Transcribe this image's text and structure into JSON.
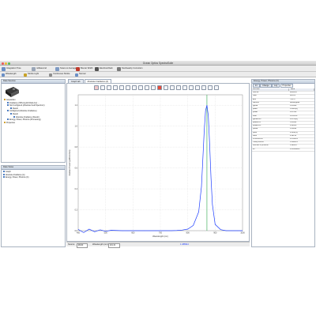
{
  "window": {
    "title": "Ocean Optics SpectraSuite"
  },
  "toolbar": {
    "buttons": [
      {
        "label": "Integration Time",
        "icon": "clock-icon",
        "color": "#6a8fc6"
      },
      {
        "label": "millisecond",
        "icon": "time-unit-icon",
        "color": "#9aa6b8"
      },
      {
        "label": "Scans to Average",
        "icon": "scans-icon",
        "color": "#7f9bc4"
      },
      {
        "label": "Boxcar Width",
        "icon": "boxcar-icon",
        "color": "#c0392b"
      },
      {
        "label": "Electrical Dark",
        "icon": "dark-icon",
        "color": "#555555"
      },
      {
        "label": "Nonlinearity Correction",
        "icon": "nonlinear-icon",
        "color": "#7a7a7a"
      }
    ]
  },
  "toolbar2": {
    "buttons": [
      {
        "label": "Wavelength",
        "icon": "wavelength-icon",
        "color": "#6a8fc6"
      },
      {
        "label": "Strobe Light",
        "icon": "strobe-icon",
        "color": "#c9a227"
      },
      {
        "label": "Continuous Strobe",
        "icon": "continuous-strobe-icon",
        "color": "#8d8d8d"
      },
      {
        "label": "Normal",
        "icon": "mode-icon",
        "color": "#6a8fc6"
      }
    ]
  },
  "left_panel": {
    "header": "Data Sources",
    "tree": [
      {
        "label": "Acquisition",
        "depth": 0
      },
      {
        "label": "Irradiance (ISIS-ing EX-Dark-Inv) ...",
        "depth": 1
      },
      {
        "label": "Not Configured (Absolute Field Spectrum)",
        "depth": 1
      },
      {
        "label": "Result",
        "depth": 2
      },
      {
        "label": "Configured (Absolute Irradiance)",
        "depth": 1
      },
      {
        "label": "Result",
        "depth": 2
      },
      {
        "label": "Absolute Irradiance (Result)",
        "depth": 3
      },
      {
        "label": "Energy, Power, Photons (Processing)",
        "depth": 1
      },
      {
        "label": "Properties",
        "depth": 0
      }
    ]
  },
  "left_lower": {
    "header": "Data Views",
    "items": [
      {
        "label": "Graph"
      },
      {
        "label": "Absolute Irradiance (A)"
      },
      {
        "label": "Energy, Power, Photons (C)"
      }
    ]
  },
  "graph": {
    "tabs": [
      {
        "label": "Graph tab"
      },
      {
        "label": "Absolute Irradiance (A)"
      }
    ],
    "ylabel": "Radiant Power (µW/cm²/nm)",
    "xlabel": "Wavelength (nm)"
  },
  "chart_data": {
    "type": "line",
    "xlabel": "Wavelength (nm)",
    "ylabel": "Radiant Power (µW/cm²/nm)",
    "xlim": [
      400,
      1000
    ],
    "ylim": [
      0,
      1.3
    ],
    "xticks": [
      "400",
      "500",
      "600",
      "700",
      "800",
      "900",
      "1000"
    ],
    "yticks": [
      "0.0",
      "0.2",
      "0.4",
      "0.6",
      "0.8",
      "1.0",
      "1.2"
    ],
    "series": [
      {
        "color": "#1f3fff",
        "x": [
          400,
          420,
          440,
          460,
          480,
          500,
          520,
          540,
          560,
          580,
          600,
          620,
          640,
          660,
          680,
          700,
          720,
          740,
          760,
          780,
          800,
          820,
          840,
          850,
          855,
          860,
          865,
          870,
          875,
          880,
          885,
          890,
          900,
          920,
          940,
          960,
          980,
          1000
        ],
        "y": [
          0.012,
          -0.018,
          0.015,
          -0.01,
          0.008,
          -0.006,
          0.004,
          0.002,
          0.0,
          0.0,
          0.0,
          0.0,
          0.0,
          0.0,
          0.0,
          0.0,
          0.0,
          0.0,
          0.002,
          0.006,
          0.015,
          0.05,
          0.18,
          0.42,
          0.68,
          0.95,
          1.15,
          1.2,
          1.1,
          0.82,
          0.5,
          0.25,
          0.06,
          0.01,
          0.0,
          0.0,
          0.0,
          0.0
        ]
      }
    ],
    "markers": [
      {
        "x": 870,
        "color": "#2aa84a"
      }
    ],
    "grid": true
  },
  "status": {
    "source_label": "Source:",
    "source_value": "RI020",
    "wavelength_label": "Wavelength (nm):",
    "wavelength_value": "191.31",
    "mode": "1.488944"
  },
  "right_panel": {
    "header": "Energy, Power, Photons (C)",
    "tabs": [
      {
        "label": "Int"
      },
      {
        "label": "Change"
      },
      {
        "label": "Log"
      },
      {
        "label": "Properties"
      }
    ],
    "columns": [
      "Attribute",
      "Value"
    ],
    "rows": [
      [
        "Source",
        "RI02081"
      ],
      [
        "Start",
        "200.24"
      ],
      [
        "End",
        "750.17"
      ],
      [
        "Method",
        "Rectangular"
      ],
      [
        "µjoule",
        "1.23493"
      ],
      [
        "µwatt",
        "1.2029(1)"
      ],
      [
        "µWatt",
        "4.27093"
      ],
      [
        "Watt",
        "4.27E-06"
      ],
      [
        "µjoule/cm²",
        "4.2709(1)"
      ],
      [
        "µwatt/cm²",
        "3.50321"
      ],
      [
        "µWatt/cm²",
        "4.42083"
      ],
      [
        "µMole",
        "1.30091"
      ],
      [
        "µMol",
        "2.1168(1)"
      ],
      [
        "Mole",
        "2.1E-12"
      ],
      [
        "Photons/cm²",
        "4.17E+12"
      ],
      [
        "Total photons",
        "1.31E+13"
      ],
      [
        "Number of photons",
        "1.3E+14"
      ],
      [
        "eV",
        "4.34181E+0"
      ]
    ]
  }
}
